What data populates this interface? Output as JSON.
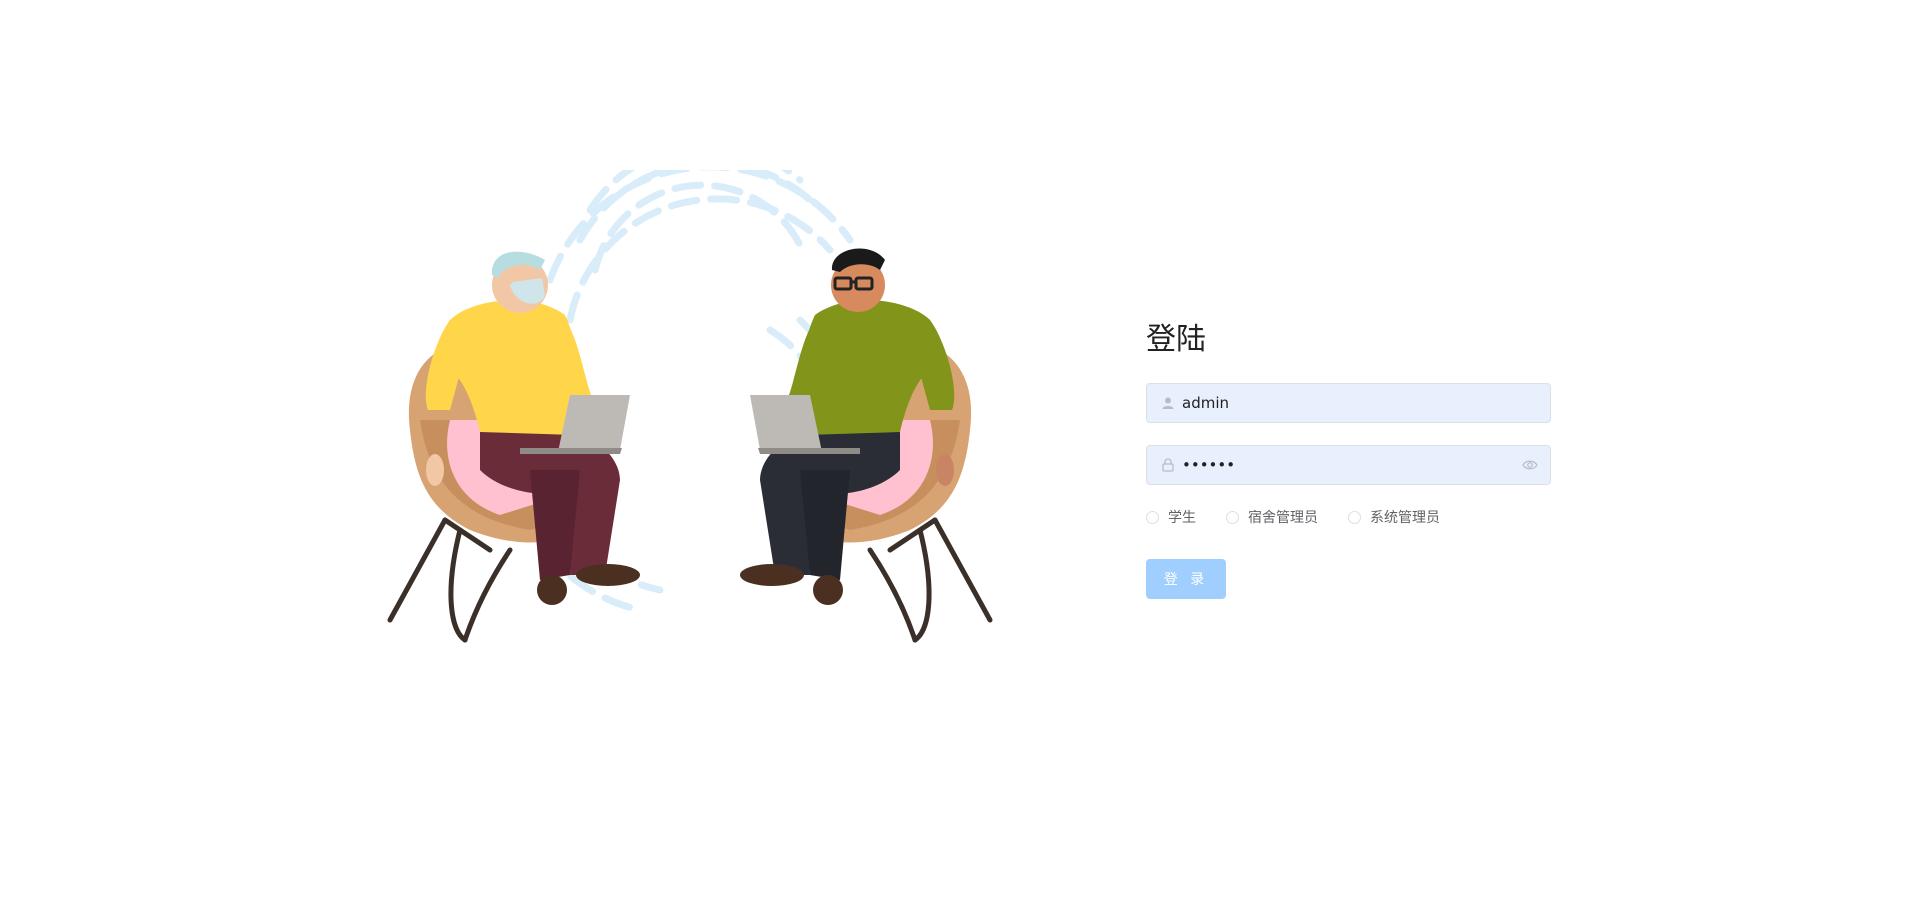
{
  "login": {
    "title": "登陆",
    "username_value": "admin",
    "password_value": "••••••",
    "roles": [
      {
        "label": "学生",
        "selected": false
      },
      {
        "label": "宿舍管理员",
        "selected": false
      },
      {
        "label": "系统管理员",
        "selected": false
      }
    ],
    "submit_label": "登 录"
  },
  "colors": {
    "input_bg": "#e8f0fe",
    "button_bg": "#a0cfff",
    "yellow_sweater": "#ffd54a",
    "green_sweater": "#82951a",
    "chair": "#d8a373"
  },
  "icons": {
    "username_prefix": "user-icon",
    "password_prefix": "lock-icon",
    "password_suffix": "eye-icon"
  }
}
